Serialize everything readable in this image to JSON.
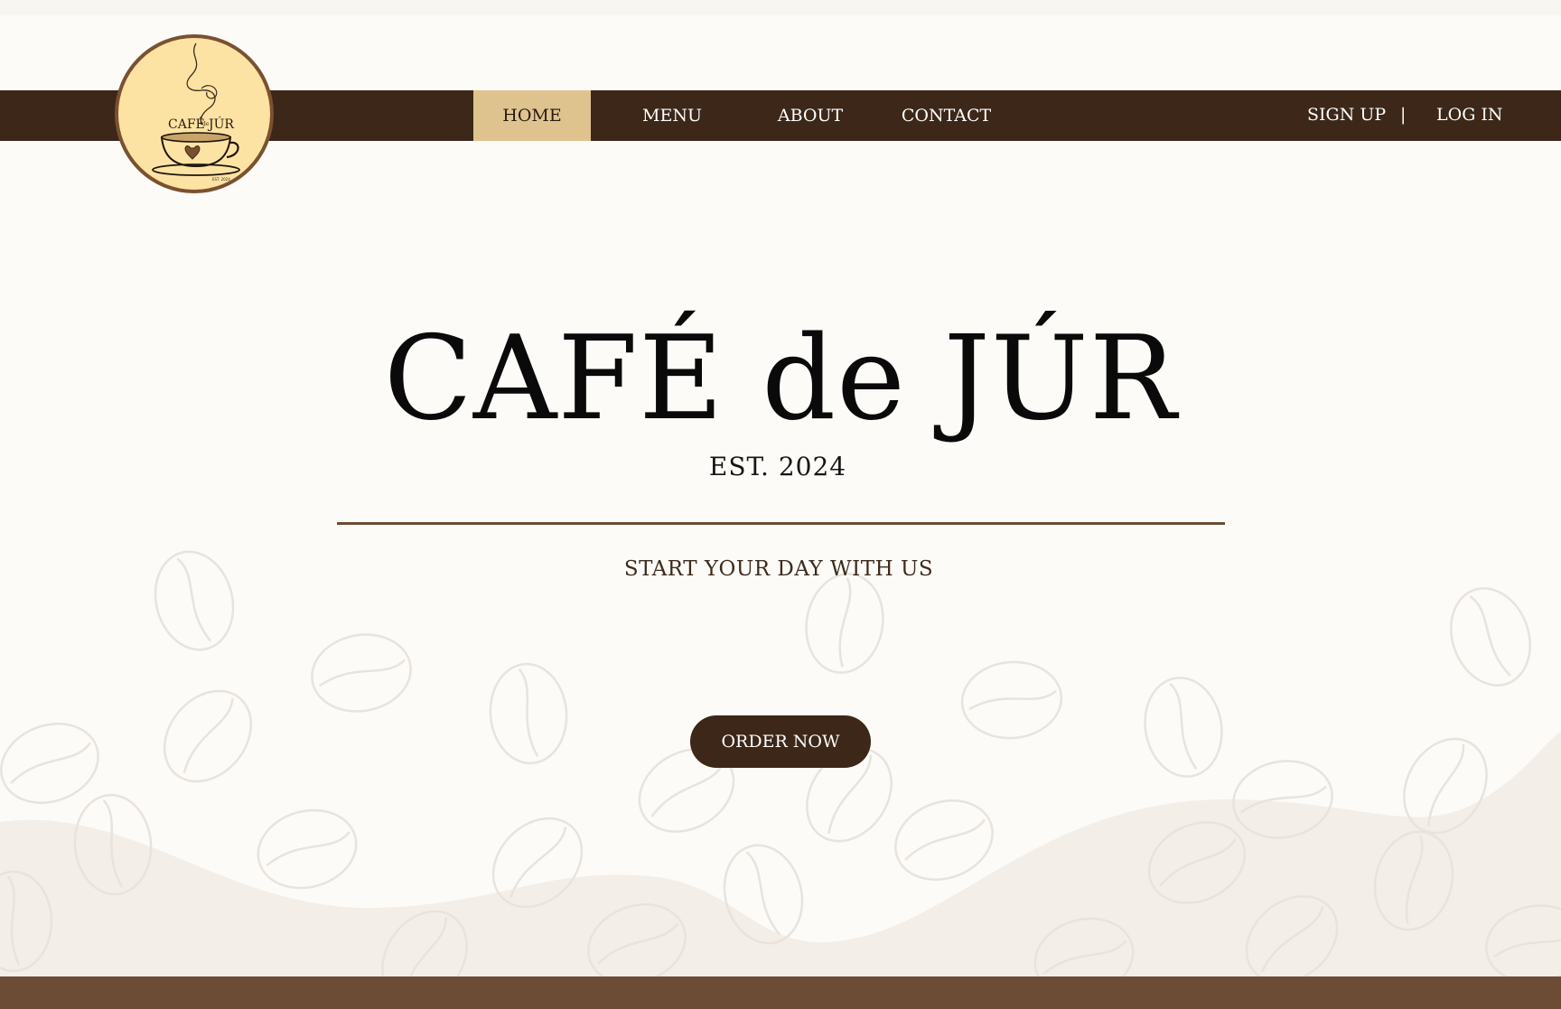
{
  "nav": {
    "items": [
      {
        "label": "HOME",
        "active": true
      },
      {
        "label": "MENU",
        "active": false
      },
      {
        "label": "ABOUT",
        "active": false
      },
      {
        "label": "CONTACT",
        "active": false
      }
    ],
    "signup": "SIGN UP",
    "separator": "|",
    "login": "LOG IN"
  },
  "logo": {
    "text_left": "CAFÉ",
    "text_small": "de",
    "text_right": "JÚR",
    "est": "EST. 2024"
  },
  "hero": {
    "title": "CAFÉ de JÚR",
    "established": "EST. 2024",
    "tagline": "START YOUR DAY WITH US",
    "cta": "ORDER NOW"
  },
  "colors": {
    "nav_bg": "#3c2718",
    "nav_active_bg": "#dfc38f",
    "page_bg": "#fcfbf8",
    "logo_bg": "#fde3a3",
    "divider": "#6b4a33",
    "footer": "#6d4c35",
    "wave": "#f3eee8"
  }
}
